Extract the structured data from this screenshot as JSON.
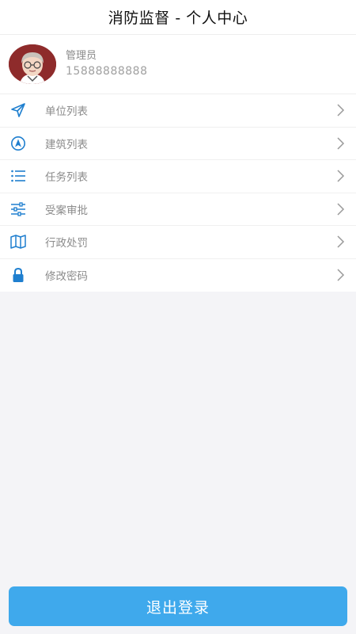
{
  "header": {
    "title": "消防监督 - 个人中心"
  },
  "profile": {
    "role": "管理员",
    "phone": "15888888888",
    "avatar_icon": "user-avatar"
  },
  "menu": {
    "items": [
      {
        "label": "单位列表",
        "icon": "send-icon"
      },
      {
        "label": "建筑列表",
        "icon": "navigation-icon"
      },
      {
        "label": "任务列表",
        "icon": "list-icon"
      },
      {
        "label": "受案审批",
        "icon": "sliders-icon"
      },
      {
        "label": "行政处罚",
        "icon": "map-icon"
      },
      {
        "label": "修改密码",
        "icon": "lock-icon"
      }
    ]
  },
  "logout": {
    "label": "退出登录"
  },
  "colors": {
    "accent": "#3fa9ec",
    "icon": "#1f7fcf",
    "avatar_bg": "#8e2b2b"
  }
}
